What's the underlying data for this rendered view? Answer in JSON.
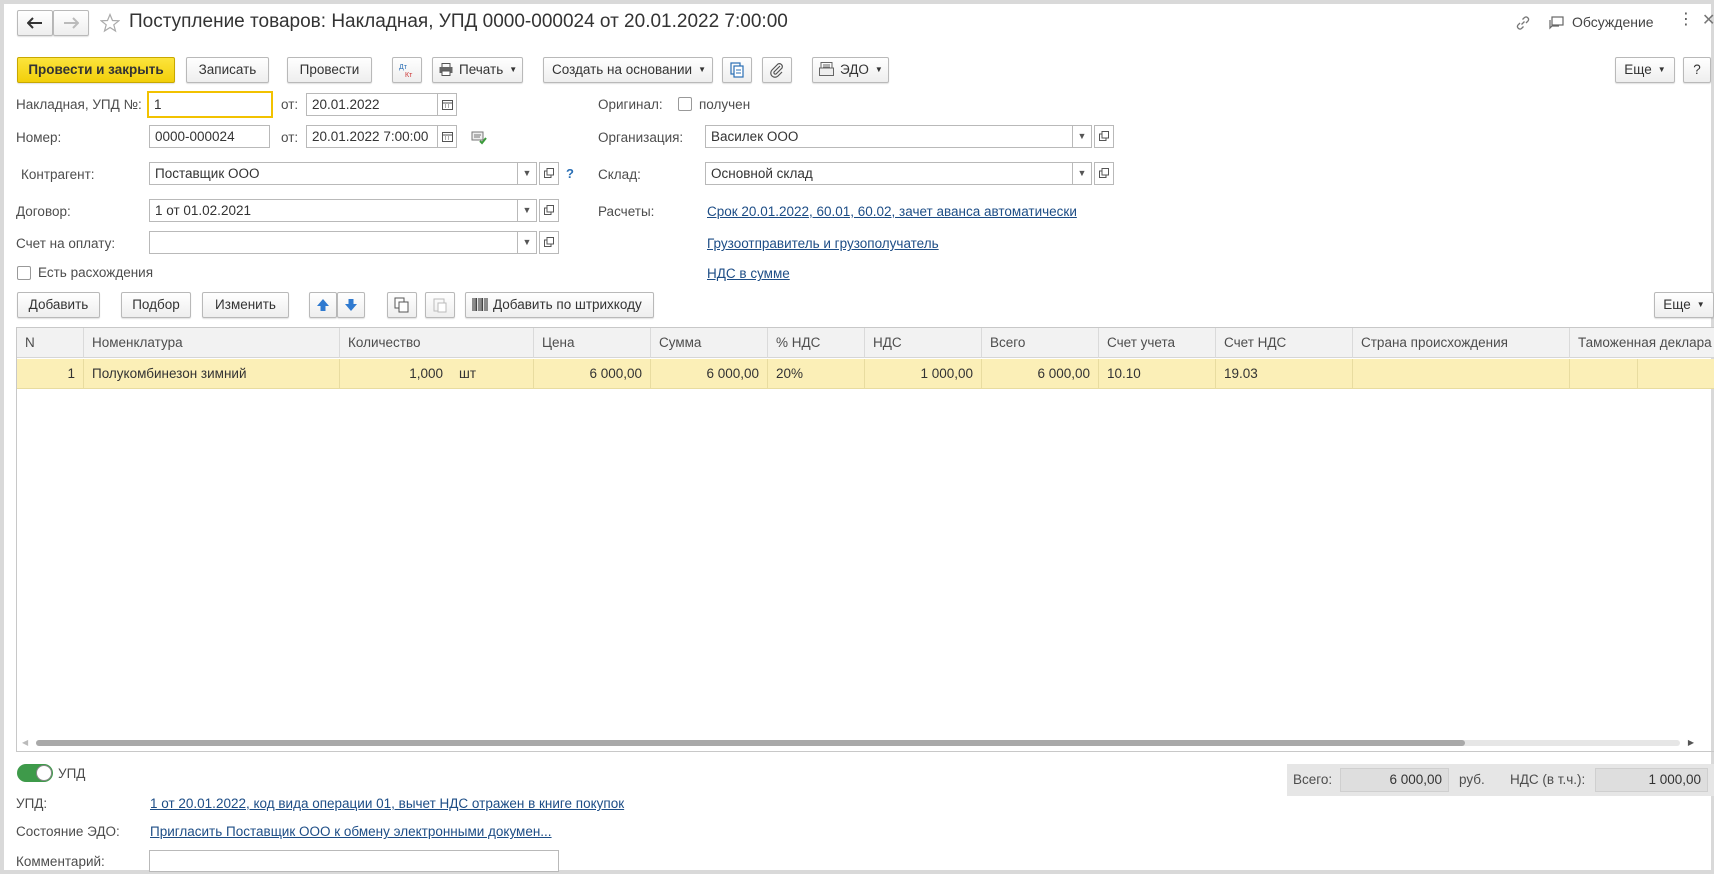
{
  "window": {
    "title": "Поступление товаров: Накладная, УПД 0000-000024 от 20.01.2022 7:00:00",
    "discussion_label": "Обсуждение"
  },
  "toolbar": {
    "post_close": "Провести и закрыть",
    "save": "Записать",
    "post": "Провести",
    "print": "Печать",
    "create_based": "Создать на основании",
    "edo": "ЭДО",
    "more": "Еще",
    "help": "?"
  },
  "header_fields": {
    "invoice_label": "Накладная, УПД №:",
    "invoice_value": "1",
    "from_label": "от:",
    "invoice_date": "20.01.2022",
    "number_label": "Номер:",
    "number_value": "0000-000024",
    "number_datetime": "20.01.2022  7:00:00",
    "counterparty_label": "Контрагент:",
    "counterparty_value": "Поставщик ООО",
    "contract_label": "Договор:",
    "contract_value": "1 от 01.02.2021",
    "payment_account_label": "Счет на оплату:",
    "payment_account_value": "",
    "discrepancies_label": "Есть расхождения",
    "original_label": "Оригинал:",
    "original_received": "получен",
    "organization_label": "Организация:",
    "organization_value": "Василек ООО",
    "warehouse_label": "Склад:",
    "warehouse_value": "Основной склад",
    "settlements_label": "Расчеты:",
    "settlements_link": "Срок 20.01.2022, 60.01, 60.02, зачет аванса автоматически",
    "shipper_link": "Грузоотправитель и грузополучатель",
    "vat_link": "НДС в сумме",
    "help_mark": "?"
  },
  "table_toolbar": {
    "add": "Добавить",
    "pick": "Подбор",
    "change": "Изменить",
    "add_barcode": "Добавить по штрихкоду",
    "more": "Еще"
  },
  "table": {
    "columns": [
      "N",
      "Номенклатура",
      "Количество",
      "Цена",
      "Сумма",
      "% НДС",
      "НДС",
      "Всего",
      "Счет учета",
      "Счет НДС",
      "Страна происхождения",
      "Таможенная деклара"
    ],
    "rows": [
      {
        "n": "1",
        "item": "Полукомбинезон зимний",
        "qty": "1,000",
        "unit": "шт",
        "price": "6 000,00",
        "sum": "6 000,00",
        "vat_rate": "20%",
        "vat": "1 000,00",
        "total": "6 000,00",
        "account": "10.10",
        "vat_account": "19.03",
        "country": "",
        "customs": ""
      }
    ]
  },
  "footer": {
    "upd_toggle_label": "УПД",
    "upd_label": "УПД:",
    "upd_link": "1 от 20.01.2022, код вида операции 01, вычет НДС отражен в книге покупок",
    "edo_state_label": "Состояние ЭДО:",
    "edo_state_link": "Пригласить Поставщик ООО к обмену электронными докумен...",
    "comment_label": "Комментарий:",
    "comment_value": "",
    "total_label": "Всего:",
    "total_value": "6 000,00",
    "currency": "руб.",
    "vat_incl_label": "НДС (в т.ч.):",
    "vat_incl_value": "1 000,00"
  }
}
